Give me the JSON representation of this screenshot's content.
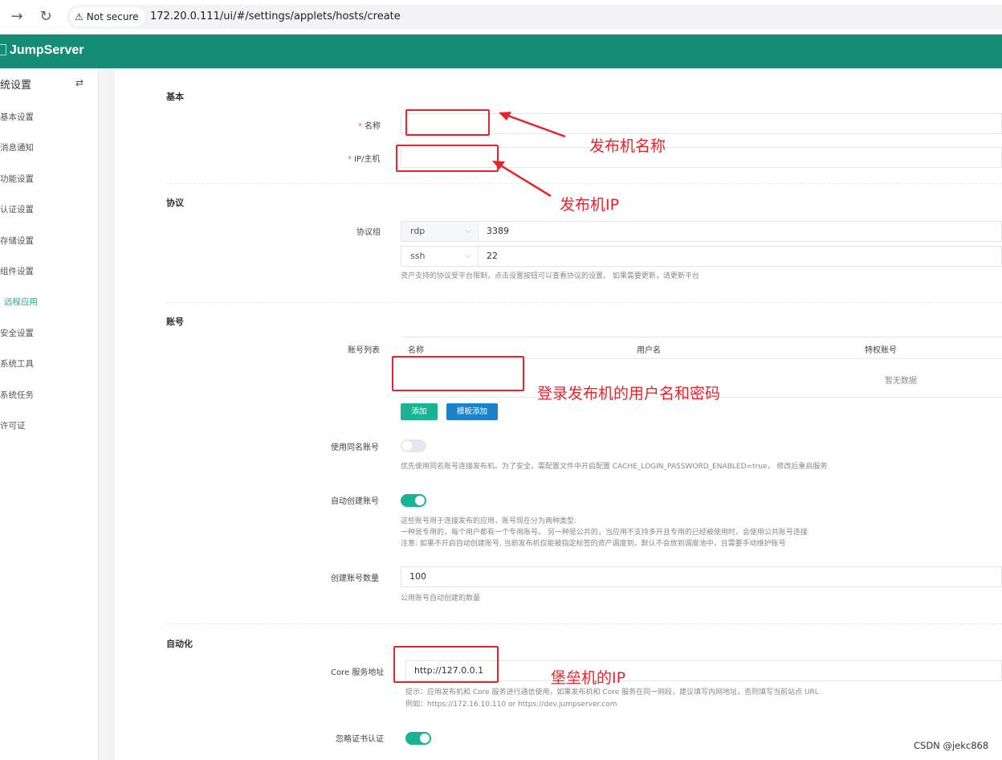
{
  "browser": {
    "secure_label": "Not secure",
    "url": "172.20.0.111/ui/#/settings/applets/hosts/create"
  },
  "app": {
    "brand": "JumpServer"
  },
  "sidebar": {
    "title": "统设置",
    "items": [
      {
        "label": "基本设置",
        "active": false
      },
      {
        "label": "消息通知",
        "active": false
      },
      {
        "label": "功能设置",
        "active": false
      },
      {
        "label": "认证设置",
        "active": false
      },
      {
        "label": "存储设置",
        "active": false
      },
      {
        "label": "组件设置",
        "active": false
      },
      {
        "label": "远程应用",
        "active": true
      },
      {
        "label": "安全设置",
        "active": false
      },
      {
        "label": "系统工具",
        "active": false
      },
      {
        "label": "系统任务",
        "active": false
      },
      {
        "label": "许可证",
        "active": false
      }
    ]
  },
  "form": {
    "basic": {
      "title": "基本",
      "name_label": "名称",
      "name_value": "",
      "ip_label": "IP/主机",
      "ip_value": ""
    },
    "protocol": {
      "title": "协议",
      "group_label": "协议组",
      "rows": [
        {
          "protocol": "rdp",
          "port": "3389"
        },
        {
          "protocol": "ssh",
          "port": "22"
        }
      ],
      "help": "资产支持的协议受平台限制，点击设置按钮可以查看协议的设置。 如果需要更新，请更新平台"
    },
    "account": {
      "title": "账号",
      "list_label": "账号列表",
      "columns": [
        "名称",
        "用户名",
        "特权账号"
      ],
      "empty_text": "暂无数据",
      "add_button": "添加",
      "template_button": "模板添加",
      "same_name_label": "使用同名账号",
      "same_name_enabled": false,
      "same_name_help": "优先使用同名账号连接发布机。为了安全，需配置文件中开启配置 CACHE_LOGIN_PASSWORD_ENABLED=true， 修改后重启服务",
      "auto_create_label": "自动创建账号",
      "auto_create_enabled": true,
      "auto_create_help_1": "这些账号用于连接发布的应用，账号现在分为两种类型:",
      "auto_create_help_2": "一种是专用的，每个用户都有一个专用账号。 另一种是公共的，当应用不支持多开且专用的已经被使用时，会使用公共账号连接",
      "auto_create_help_3": "注意: 如果不开启自动创建账号, 当前发布机仅能被指定标签的资产调度到，默认不会放到调度池中，且需要手动维护账号",
      "count_label": "创建账号数量",
      "count_value": "100",
      "count_help": "公用账号自动创建的数量"
    },
    "automation": {
      "title": "自动化",
      "core_label": "Core 服务地址",
      "core_value": "http://127.0.0.1",
      "core_help_1": "提示：应用发布机和 Core 服务进行通信使用，如果发布机和 Core 服务在同一网段，建议填写内网地址，否则填写当前站点 URL",
      "core_help_2": "例如：https://172.16.10.110 or https://dev.jumpserver.com",
      "ignore_cert_label": "忽略证书认证",
      "ignore_cert_enabled": true
    }
  },
  "annotations": {
    "name": "发布机名称",
    "ip": "发布机IP",
    "account": "登录发布机的用户名和密码",
    "core": "堡垒机的IP"
  },
  "watermark": "CSDN @jekc868",
  "colors": {
    "header": "#148d74",
    "accent": "#1ab394",
    "primary": "#1c84c6",
    "annotation": "#e8232b"
  }
}
